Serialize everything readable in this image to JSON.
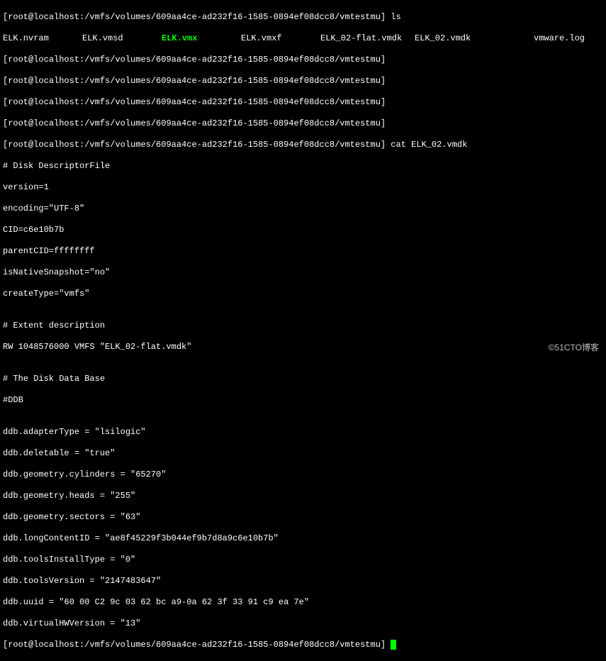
{
  "prompt": {
    "open": "[",
    "user_host": "root@localhost",
    "sep": ":",
    "path": "/vmfs/volumes/609aa4ce-ad232f16-1585-0894ef08dcc8/vmtestmu",
    "close": "]"
  },
  "cmd_ls": " ls",
  "files": {
    "f1": "ELK.nvram",
    "f2": "ELK.vmsd",
    "f3": "ELK.vmx",
    "f4": "ELK.vmxf",
    "f5": "ELK_02-flat.vmdk",
    "f6": "ELK_02.vmdk",
    "f7": "vmware.log"
  },
  "cmd_cat": " cat ELK_02.vmdk",
  "content": {
    "l1": "# Disk DescriptorFile",
    "l2": "version=1",
    "l3": "encoding=\"UTF-8\"",
    "l4": "CID=c6e10b7b",
    "l5": "parentCID=ffffffff",
    "l6": "isNativeSnapshot=\"no\"",
    "l7": "createType=\"vmfs\"",
    "l8": "",
    "l9": "# Extent description",
    "l10": "RW 1048576000 VMFS \"ELK_02-flat.vmdk\"",
    "l11": "",
    "l12": "# The Disk Data Base",
    "l13": "#DDB",
    "l14": "",
    "l15": "ddb.adapterType = \"lsilogic\"",
    "l16": "ddb.deletable = \"true\"",
    "l17": "ddb.geometry.cylinders = \"65270\"",
    "l18": "ddb.geometry.heads = \"255\"",
    "l19": "ddb.geometry.sectors = \"63\"",
    "l20": "ddb.longContentID = \"ae8f45229f3b044ef9b7d8a9c6e10b7b\"",
    "l21": "ddb.toolsInstallType = \"0\"",
    "l22": "ddb.toolsVersion = \"2147483647\"",
    "l23": "ddb.uuid = \"60 00 C2 9c 03 62 bc a9-0a 62 3f 33 91 c9 ea 7e\"",
    "l24": "ddb.virtualHWVersion = \"13\""
  },
  "watermark": "©51CTO博客"
}
